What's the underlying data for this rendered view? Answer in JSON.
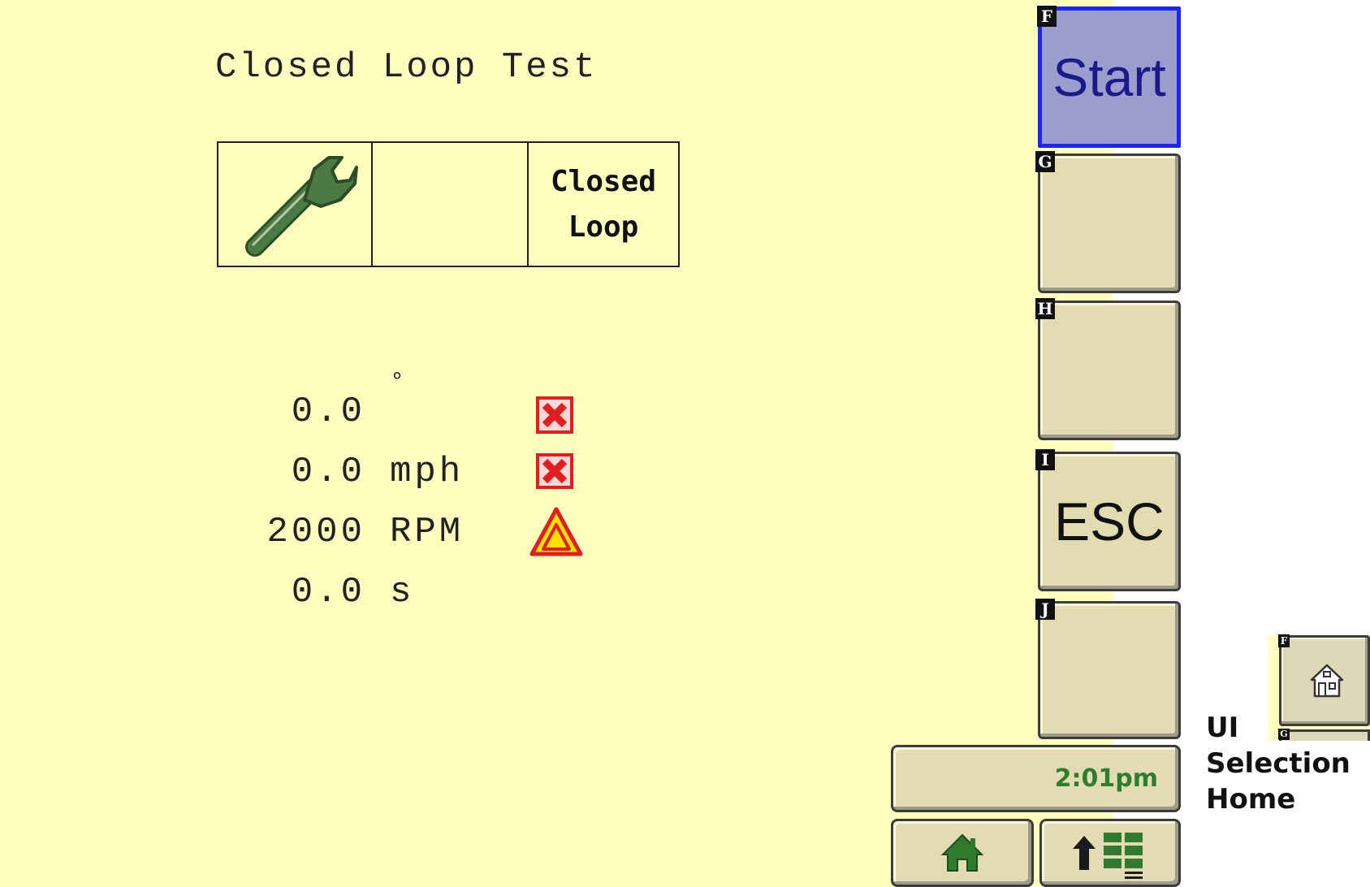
{
  "screen": {
    "title": "Closed Loop Test",
    "status_table": {
      "icon": "wrench-icon",
      "middle": "",
      "mode_line1": "Closed",
      "mode_line2": "Loop"
    },
    "readings": [
      {
        "value": "0.0",
        "unit": "°",
        "indicator": "error-x-icon"
      },
      {
        "value": "0.0",
        "unit": "mph",
        "indicator": "error-x-icon"
      },
      {
        "value": "2000",
        "unit": "RPM",
        "indicator": "warning-triangle-icon"
      },
      {
        "value": "0.0",
        "unit": "s",
        "indicator": ""
      }
    ]
  },
  "softkeys": [
    {
      "letter": "F",
      "label": "Start",
      "active": true
    },
    {
      "letter": "G",
      "label": ""
    },
    {
      "letter": "H",
      "label": ""
    },
    {
      "letter": "I",
      "label": "ESC"
    },
    {
      "letter": "J",
      "label": ""
    }
  ],
  "clock": "2:01pm",
  "nav": {
    "home_icon": "home-icon",
    "menu_icon": "up-arrow-menu-icon"
  },
  "annotation": {
    "line1": "UI",
    "line2": "Selection",
    "line3": "Home"
  },
  "mini_preview": {
    "letter": "F",
    "icon": "home-outline-icon",
    "letter2": "G"
  },
  "colors": {
    "screen_bg": "#ffffc0",
    "softkey_bg": "#e3dcb2",
    "active_key_bg": "#9b9dcc",
    "active_border": "#1c24ff",
    "clock_text": "#2f7d2f",
    "icon_green": "#3d6b35",
    "error_red": "#e02020",
    "warning_yellow": "#ffe000"
  }
}
